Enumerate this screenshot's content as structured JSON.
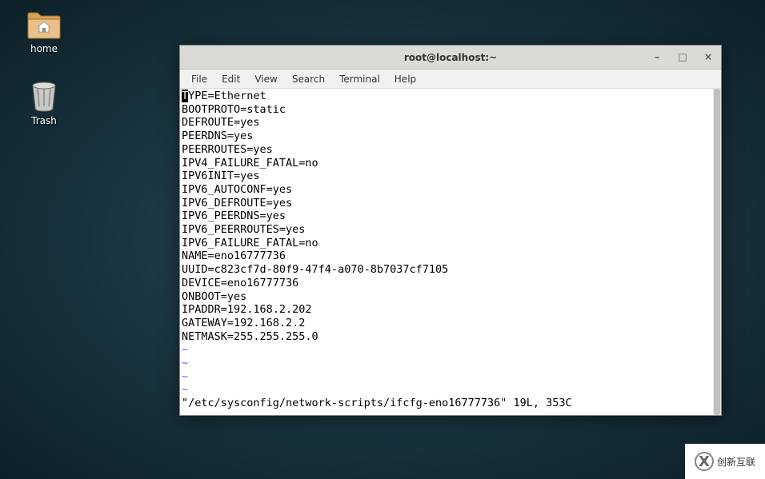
{
  "desktop": {
    "icons": {
      "home": {
        "label": "home"
      },
      "trash": {
        "label": "Trash"
      }
    }
  },
  "terminal": {
    "title": "root@localhost:~",
    "menu": {
      "file": "File",
      "edit": "Edit",
      "view": "View",
      "search": "Search",
      "terminal": "Terminal",
      "help": "Help"
    },
    "content": {
      "cursor_char": "T",
      "first_line_rest": "YPE=Ethernet",
      "lines": [
        "BOOTPROTO=static",
        "DEFROUTE=yes",
        "PEERDNS=yes",
        "PEERROUTES=yes",
        "IPV4_FAILURE_FATAL=no",
        "IPV6INIT=yes",
        "IPV6_AUTOCONF=yes",
        "IPV6_DEFROUTE=yes",
        "IPV6_PEERDNS=yes",
        "IPV6_PEERROUTES=yes",
        "IPV6_FAILURE_FATAL=no",
        "NAME=eno16777736",
        "UUID=c823cf7d-80f9-47f4-a070-8b7037cf7105",
        "DEVICE=eno16777736",
        "ONBOOT=yes",
        "IPADDR=192.168.2.202",
        "GATEWAY=192.168.2.2",
        "NETMASK=255.255.255.0"
      ],
      "tilde_lines": [
        "~",
        "~",
        "~",
        "~"
      ],
      "status_line": "\"/etc/sysconfig/network-scripts/ifcfg-eno16777736\" 19L, 353C"
    }
  },
  "watermark": {
    "text": "创新互联"
  }
}
